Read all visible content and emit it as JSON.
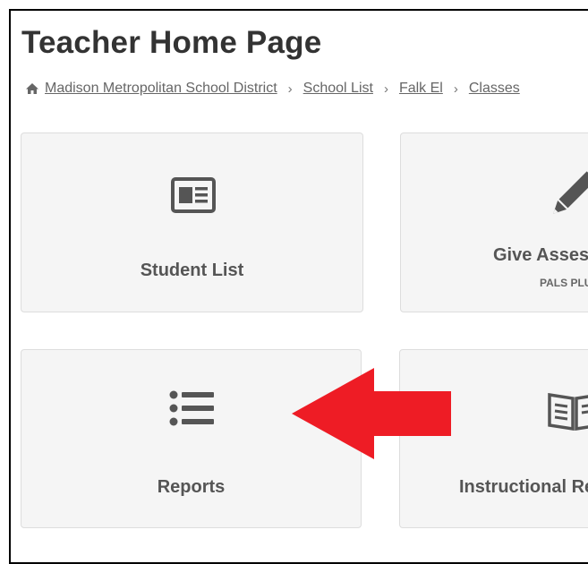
{
  "page": {
    "title": "Teacher Home Page"
  },
  "breadcrumb": {
    "home_icon": "home-icon",
    "items": [
      "Madison Metropolitan School District",
      "School List",
      "Falk El",
      "Classes"
    ],
    "separator": "›"
  },
  "tiles": [
    {
      "label": "Student List",
      "icon": "id-card-icon"
    },
    {
      "label": "Give Assessments",
      "sublabel": "PALS PLUS",
      "icon": "pencil-icon"
    },
    {
      "label": "Reports",
      "icon": "list-icon"
    },
    {
      "label": "Instructional Resources",
      "icon": "book-icon"
    }
  ],
  "annotation": {
    "arrow_color": "#ee1c25",
    "icon": "arrow-left-icon"
  },
  "colors": {
    "tile_bg": "#f5f5f5",
    "tile_border": "#dddddd",
    "icon": "#555555",
    "text": "#333333"
  }
}
